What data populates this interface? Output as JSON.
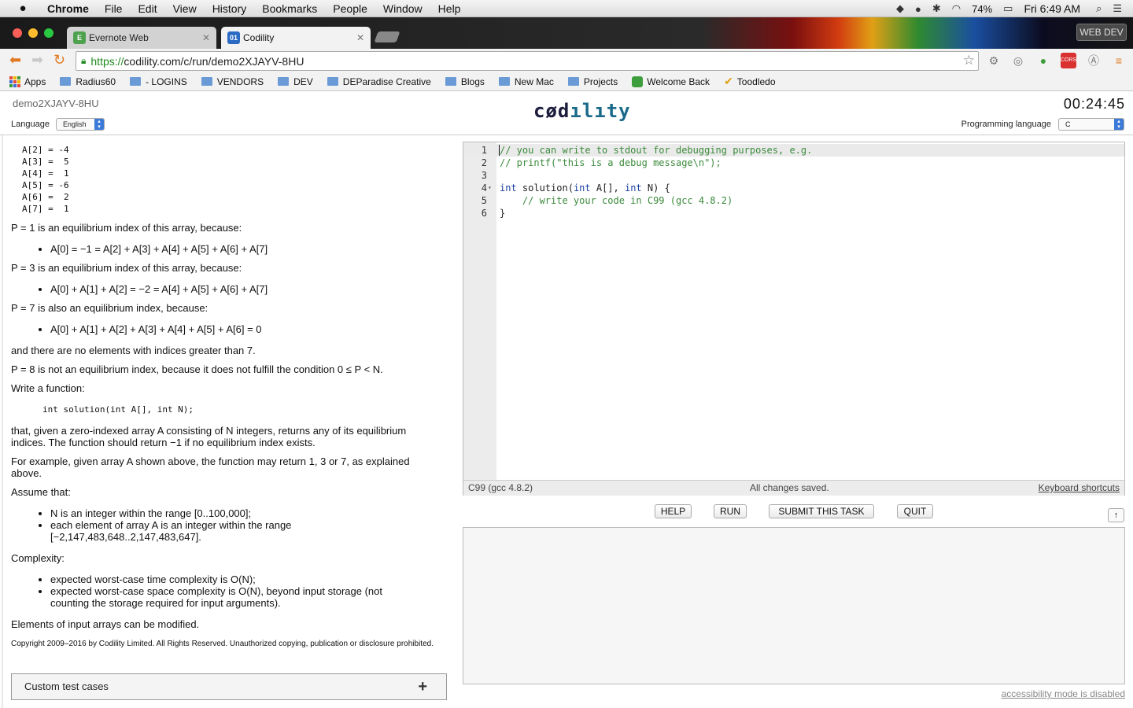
{
  "menubar": {
    "app": "Chrome",
    "items": [
      "File",
      "Edit",
      "View",
      "History",
      "Bookmarks",
      "People",
      "Window",
      "Help"
    ],
    "battery": "74%",
    "clock": "Fri 6:49 AM"
  },
  "tabs": [
    {
      "title": "Evernote Web",
      "favicon": "evernote-icon"
    },
    {
      "title": "Codility",
      "favicon": "codility-icon"
    }
  ],
  "profile_button": "WEB DEV",
  "omnibox": {
    "scheme": "https://",
    "rest": "codility.com/c/run/demo2XJAYV-8HU"
  },
  "bookmarks": [
    "Apps",
    "Radius60",
    "- LOGINS",
    "VENDORS",
    "DEV",
    "DEParadise Creative",
    "Blogs",
    "New Mac",
    "Projects",
    "Welcome Back",
    "Toodledo"
  ],
  "header": {
    "task_id": "demo2XJAYV-8HU",
    "language_label": "Language",
    "language_value": "English",
    "logo": {
      "a": "c",
      "b": "ø",
      "c": "d",
      "d": "ı",
      "e": "l",
      "f": "ı",
      "g": "ty"
    },
    "timer": "00:24:45",
    "prog_lang_label": "Programming language",
    "prog_lang_value": "C"
  },
  "task": {
    "array_lines": "A[2] = -4\nA[3] =  5\nA[4] =  1\nA[5] = -6\nA[6] =  2\nA[7] =  1",
    "p1": "P = 1 is an equilibrium index of this array, because:",
    "p1_item": "A[0] = −1 = A[2] + A[3] + A[4] + A[5] + A[6] + A[7]",
    "p2": "P = 3 is an equilibrium index of this array, because:",
    "p2_item": "A[0] + A[1] + A[2] = −2 = A[4] + A[5] + A[6] + A[7]",
    "p3": "P = 7 is also an equilibrium index, because:",
    "p3_item": "A[0] + A[1] + A[2] + A[3] + A[4] + A[5] + A[6] = 0",
    "p4": "and there are no elements with indices greater than 7.",
    "p5": "P = 8 is not an equilibrium index, because it does not fulfill the condition 0 ≤ P < N.",
    "p6": "Write a function:",
    "signature": "int solution(int A[], int N);",
    "p7": "that, given a zero-indexed array A consisting of N integers, returns any of its equilibrium indices. The function should return −1 if no equilibrium index exists.",
    "p8": "For example, given array A shown above, the function may return 1, 3 or 7, as explained above.",
    "p9": "Assume that:",
    "assume": [
      "N is an integer within the range [0..100,000];",
      "each element of array A is an integer within the range [−2,147,483,648..2,147,483,647]."
    ],
    "p10": "Complexity:",
    "complexity": [
      "expected worst-case time complexity is O(N);",
      "expected worst-case space complexity is O(N), beyond input storage (not counting the storage required for input arguments)."
    ],
    "p11": "Elements of input arrays can be modified.",
    "copyright": "Copyright 2009–2016 by Codility Limited. All Rights Reserved. Unauthorized copying, publication or disclosure prohibited.",
    "custom_tests": "Custom test cases"
  },
  "editor": {
    "line_numbers": [
      "1",
      "2",
      "3",
      "4",
      "5",
      "6"
    ],
    "l1": "// you can write to stdout for debugging purposes, e.g.",
    "l2": "// printf(\"this is a debug message\\n\");",
    "l4_kw1": "int",
    "l4_mid1": " solution(",
    "l4_kw2": "int",
    "l4_mid2": " A[], ",
    "l4_kw3": "int",
    "l4_end": " N) {",
    "l5": "    // write your code in C99 (gcc 4.8.2)",
    "l6": "}",
    "status_lang": "C99 (gcc 4.8.2)",
    "status_saved": "All changes saved.",
    "shortcuts": "Keyboard shortcuts"
  },
  "buttons": {
    "help": "HELP",
    "run": "RUN",
    "submit": "SUBMIT THIS TASK",
    "quit": "QUIT",
    "up": "↑"
  },
  "accessibility": "accessibility mode is disabled"
}
